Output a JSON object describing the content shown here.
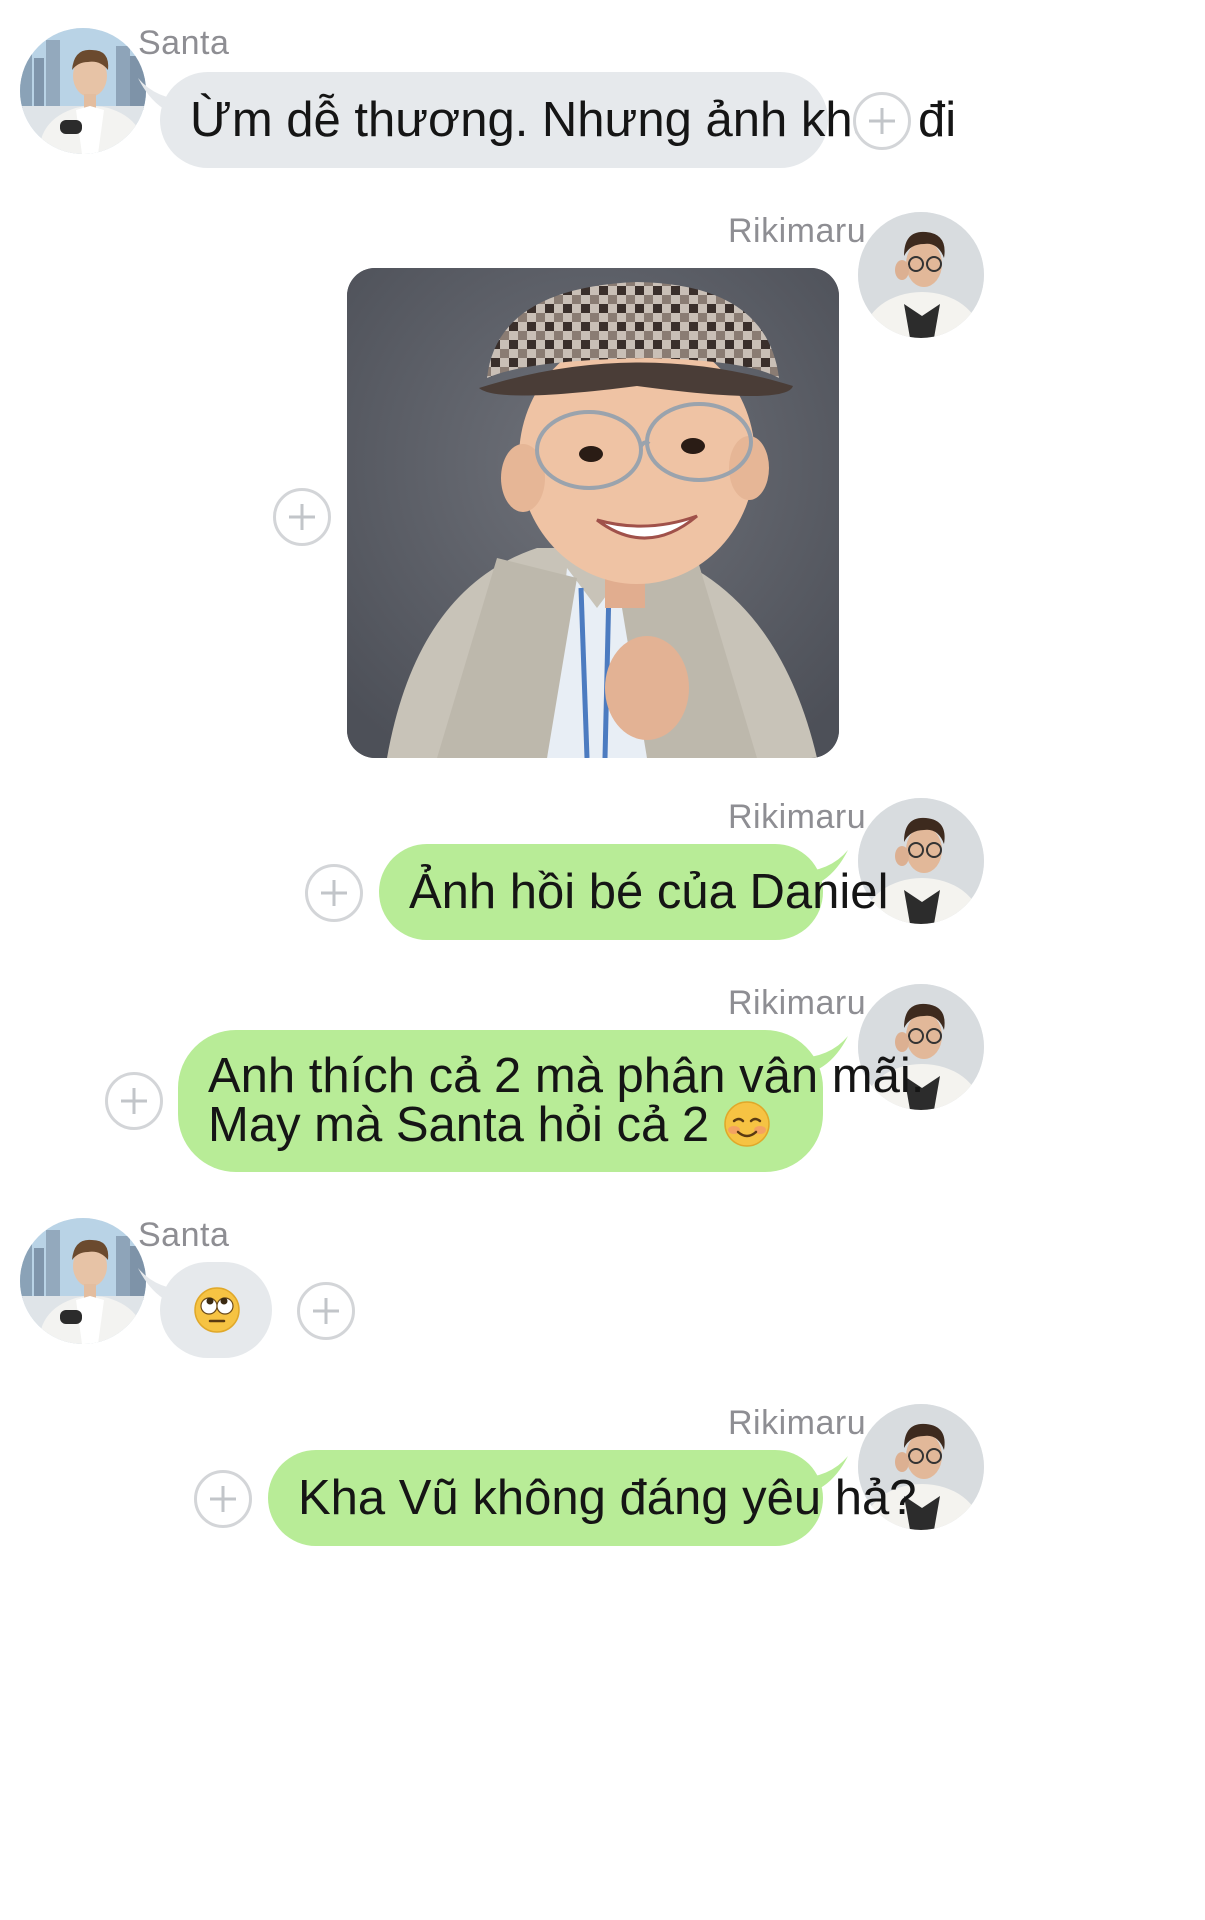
{
  "chat": {
    "messages": [
      {
        "sender": "Santa",
        "type": "text",
        "text": "Ừm dễ thương. Nhưng ảnh khác đi"
      },
      {
        "sender": "Rikimaru",
        "type": "image",
        "image_description": "child photo with checkered cap and glasses"
      },
      {
        "sender": "Rikimaru",
        "type": "text",
        "text": "Ảnh hồi bé của Daniel"
      },
      {
        "sender": "Rikimaru",
        "type": "text",
        "line1": "Anh thích cả 2 mà phân vân mãi.",
        "line2": "May mà Santa hỏi cả 2",
        "emoji": "smiling-face-icon"
      },
      {
        "sender": "Santa",
        "type": "emoji",
        "emoji": "eye-roll-face-icon"
      },
      {
        "sender": "Rikimaru",
        "type": "text",
        "text": "Kha Vũ không đáng yêu hả?"
      }
    ]
  },
  "colors": {
    "incoming_bubble": "#e6e9ec",
    "outgoing_bubble": "#b8ec97",
    "name_text": "#8e8e93",
    "plus_border": "#d3d5d8"
  }
}
